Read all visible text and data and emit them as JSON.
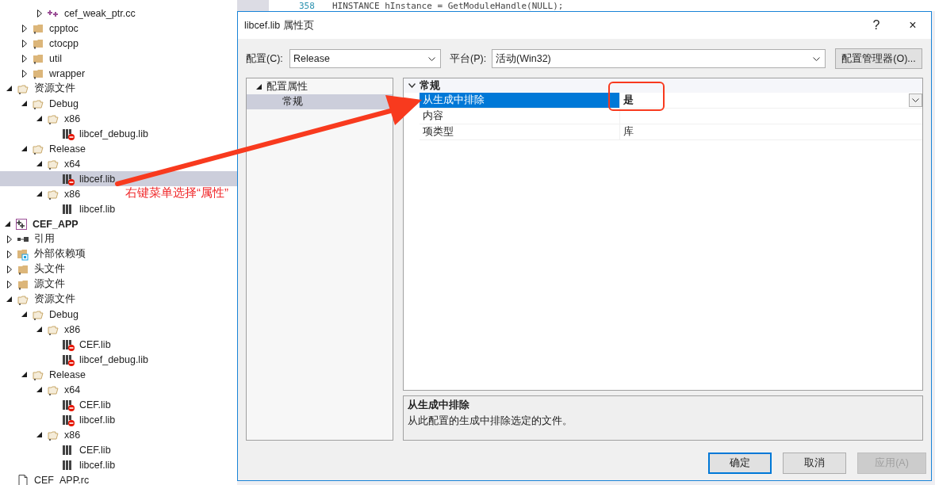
{
  "solution_tree": [
    {
      "children": [
        {
          "children": [
            {
              "children": [
                {
                  "label": "cef_weak_ptr.cc",
                  "kind": "cpp",
                  "expanded": false,
                  "selected": false
                }
              ]
            },
            {
              "label": "cpptoc",
              "kind": "folder",
              "expanded": false,
              "selected": false
            },
            {
              "label": "ctocpp",
              "kind": "folder",
              "expanded": false,
              "selected": false
            },
            {
              "label": "util",
              "kind": "folder",
              "expanded": false,
              "selected": false
            },
            {
              "label": "wrapper",
              "kind": "folder",
              "expanded": false,
              "selected": false
            }
          ]
        },
        {
          "label": "资源文件",
          "kind": "folder",
          "expanded": true,
          "selected": false,
          "children": [
            {
              "label": "Debug",
              "kind": "folder",
              "expanded": true,
              "selected": false,
              "children": [
                {
                  "label": "x86",
                  "kind": "folder",
                  "expanded": true,
                  "selected": false,
                  "children": [
                    {
                      "label": "libcef_debug.lib",
                      "kind": "lib",
                      "excluded": true,
                      "selected": false
                    }
                  ]
                }
              ]
            },
            {
              "label": "Release",
              "kind": "folder",
              "expanded": true,
              "selected": false,
              "children": [
                {
                  "label": "x64",
                  "kind": "folder",
                  "expanded": true,
                  "selected": false,
                  "children": [
                    {
                      "label": "libcef.lib",
                      "kind": "lib",
                      "excluded": true,
                      "selected": true
                    }
                  ]
                },
                {
                  "label": "x86",
                  "kind": "folder",
                  "expanded": true,
                  "selected": false,
                  "children": [
                    {
                      "label": "libcef.lib",
                      "kind": "lib",
                      "excluded": false,
                      "selected": false
                    }
                  ]
                }
              ]
            }
          ]
        }
      ]
    },
    {
      "label": "CEF_APP",
      "kind": "project",
      "expanded": true,
      "selected": false,
      "children": [
        {
          "label": "引用",
          "kind": "references",
          "expanded": false,
          "selected": false
        },
        {
          "label": "外部依赖项",
          "kind": "external",
          "expanded": false,
          "selected": false
        },
        {
          "label": "头文件",
          "kind": "folder",
          "expanded": false,
          "selected": false
        },
        {
          "label": "源文件",
          "kind": "folder",
          "expanded": false,
          "selected": false
        },
        {
          "label": "资源文件",
          "kind": "folder",
          "expanded": true,
          "selected": false,
          "children": [
            {
              "label": "Debug",
              "kind": "folder",
              "expanded": true,
              "selected": false,
              "children": [
                {
                  "label": "x86",
                  "kind": "folder",
                  "expanded": true,
                  "selected": false,
                  "children": [
                    {
                      "label": "CEF.lib",
                      "kind": "lib",
                      "excluded": true,
                      "selected": false
                    },
                    {
                      "label": "libcef_debug.lib",
                      "kind": "lib",
                      "excluded": true,
                      "selected": false
                    }
                  ]
                }
              ]
            },
            {
              "label": "Release",
              "kind": "folder",
              "expanded": true,
              "selected": false,
              "children": [
                {
                  "label": "x64",
                  "kind": "folder",
                  "expanded": true,
                  "selected": false,
                  "children": [
                    {
                      "label": "CEF.lib",
                      "kind": "lib",
                      "excluded": true,
                      "selected": false
                    },
                    {
                      "label": "libcef.lib",
                      "kind": "lib",
                      "excluded": true,
                      "selected": false
                    }
                  ]
                },
                {
                  "label": "x86",
                  "kind": "folder",
                  "expanded": true,
                  "selected": false,
                  "children": [
                    {
                      "label": "CEF.lib",
                      "kind": "lib",
                      "excluded": false,
                      "selected": false
                    },
                    {
                      "label": "libcef.lib",
                      "kind": "lib",
                      "excluded": false,
                      "selected": false
                    }
                  ]
                }
              ]
            }
          ]
        },
        {
          "label": "CEF_APP.rc",
          "kind": "rc",
          "selected": false
        }
      ]
    }
  ],
  "editor": {
    "line_number": "358",
    "code": "HINSTANCE hInstance = GetModuleHandle(NULL);"
  },
  "dialog": {
    "title": "libcef.lib 属性页",
    "help": "?",
    "close": "×",
    "config_label": "配置(C):",
    "config_value": "Release",
    "platform_label": "平台(P):",
    "platform_value": "活动(Win32)",
    "manager_button": "配置管理器(O)...",
    "nav": [
      {
        "label": "配置属性",
        "expanded": true,
        "selected": false,
        "children": [
          {
            "label": "常规",
            "selected": true
          }
        ]
      }
    ],
    "category": {
      "label": "常规",
      "expanded": true
    },
    "properties": [
      {
        "name": "从生成中排除",
        "value": "是",
        "selected": true
      },
      {
        "name": "内容",
        "selected": false
      },
      {
        "name": "项类型",
        "value": "库",
        "selected": false
      }
    ],
    "description_title": "从生成中排除",
    "description": "从此配置的生成中排除选定的文件。",
    "buttons": [
      {
        "label": "确定",
        "kind": "default",
        "disabled": false
      },
      {
        "label": "取消",
        "kind": "normal",
        "disabled": false
      },
      {
        "label": "应用(A)",
        "kind": "normal",
        "disabled": true
      }
    ]
  },
  "annotation": {
    "text": "右键菜单选择“属性”"
  }
}
